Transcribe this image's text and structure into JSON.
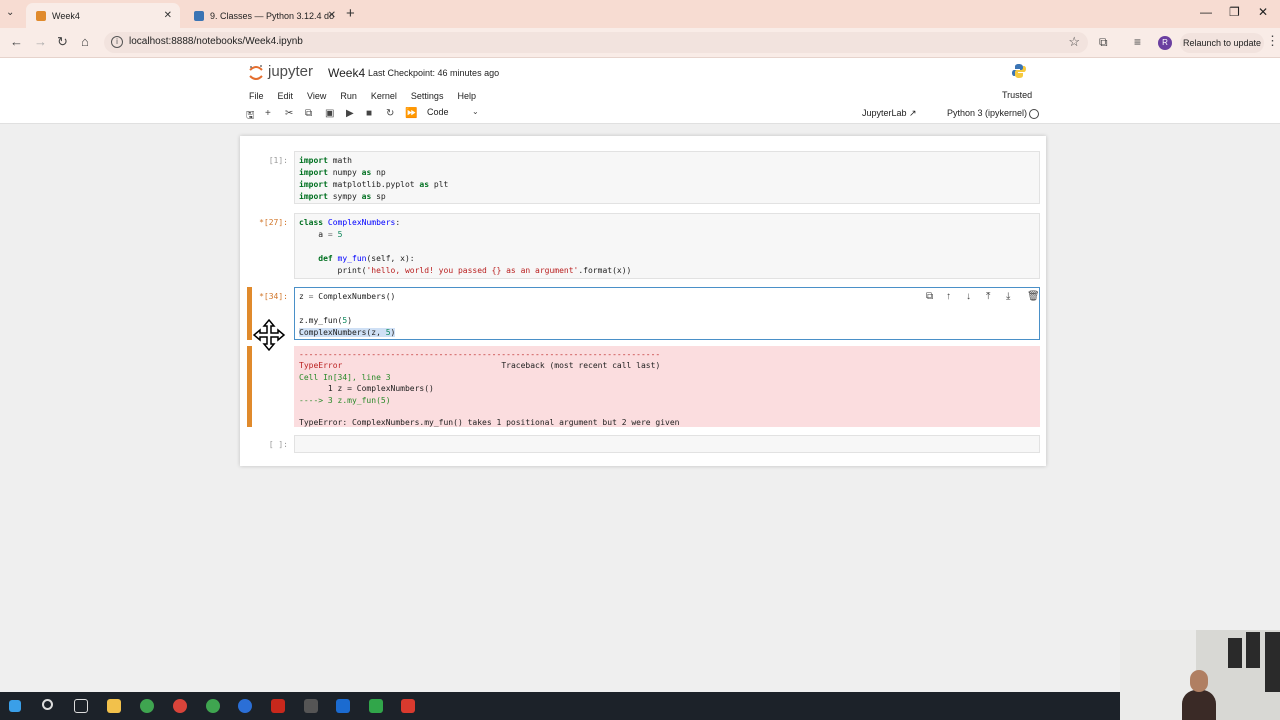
{
  "browser": {
    "tabs": [
      {
        "title": "Week4",
        "active": true
      },
      {
        "title": "9. Classes — Python 3.12.4 do",
        "active": false
      }
    ],
    "url": "localhost:8888/notebooks/Week4.ipynb",
    "relaunch_label": "Relaunch to update",
    "profile_initial": "R"
  },
  "jupyter": {
    "logo_text": "jupyter",
    "notebook_name": "Week4",
    "checkpoint": "Last Checkpoint: 46 minutes ago",
    "menu": [
      "File",
      "Edit",
      "View",
      "Run",
      "Kernel",
      "Settings",
      "Help"
    ],
    "trusted": "Trusted",
    "cell_type": "Code",
    "jupyterlab_link": "JupyterLab",
    "kernel": "Python 3 (ipykernel)"
  },
  "cells": [
    {
      "prompt": "[1]:"
    },
    {
      "prompt": "[27]:"
    },
    {
      "prompt": "[34]:"
    },
    {
      "prompt": "[ ]:"
    }
  ],
  "error": {
    "dashes": "---------------------------------------------------------------------------",
    "type": "TypeError",
    "traceback_label": "Traceback (most recent call last)",
    "cell_ref": "Cell In[34], line 3",
    "line1": "      1 z = ComplexNumbers()",
    "line3": "----> 3 z.my_fun(5)",
    "message": "TypeError: ComplexNumbers.my_fun() takes 1 positional argument but 2 were given"
  },
  "colors": {
    "accent": "#e08a2c",
    "error_bg": "#fbdddf",
    "tab_strip": "#f7dcd2"
  }
}
